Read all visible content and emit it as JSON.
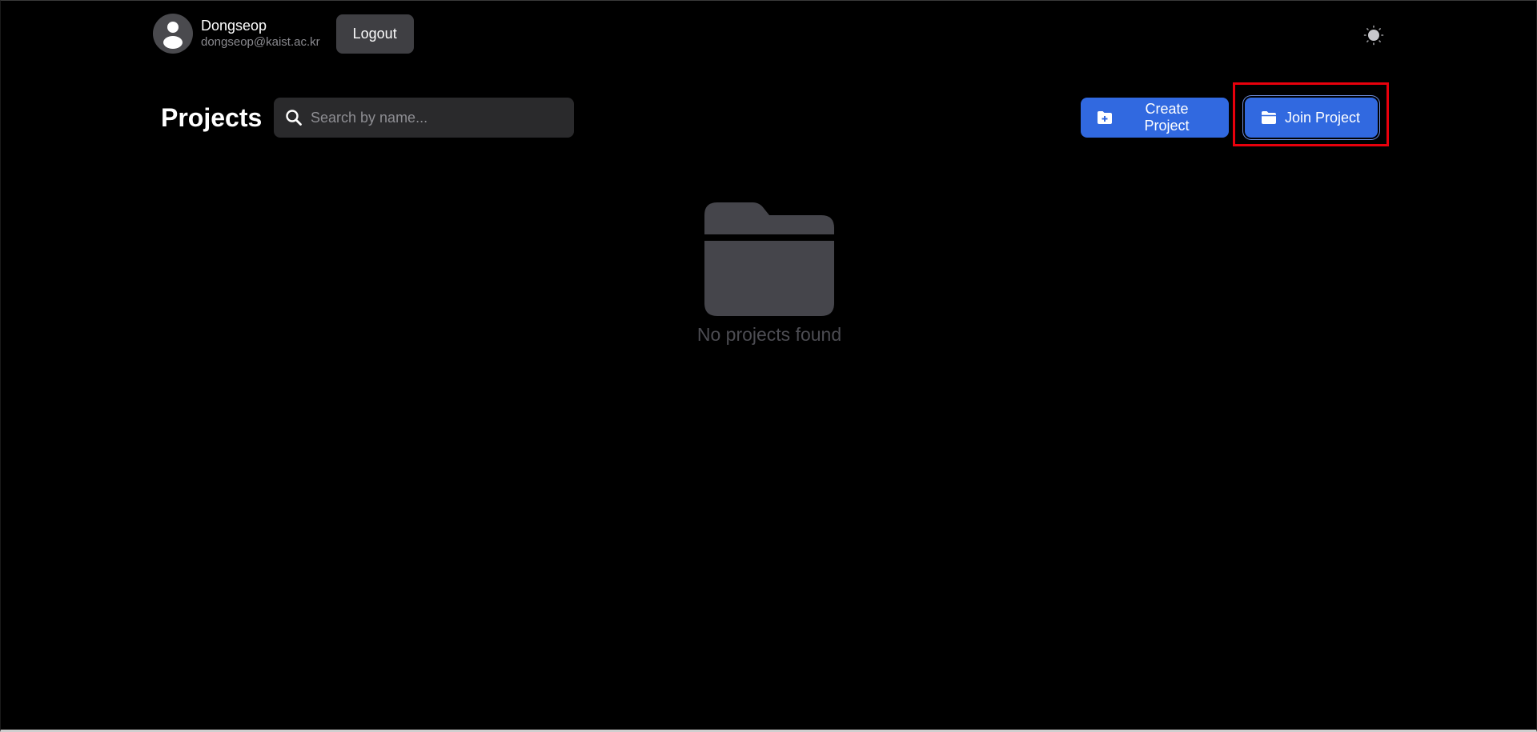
{
  "user": {
    "name": "Dongseop",
    "email": "dongseop@kaist.ac.kr",
    "avatar_icon": "user-avatar-icon"
  },
  "header": {
    "logout_label": "Logout",
    "theme_icon": "sun-icon"
  },
  "projects": {
    "title": "Projects",
    "search": {
      "placeholder": "Search by name...",
      "value": "",
      "icon": "search-icon"
    },
    "create_label": "Create Project",
    "create_icon": "folder-plus-icon",
    "join_label": "Join Project",
    "join_icon": "folder-open-icon",
    "empty": {
      "icon": "folder-icon",
      "message": "No projects found"
    }
  },
  "colors": {
    "background": "#000000",
    "primary": "#3169e0",
    "muted_surface": "#3f3f43",
    "empty_icon": "#45454b",
    "highlight": "#e8000c"
  }
}
